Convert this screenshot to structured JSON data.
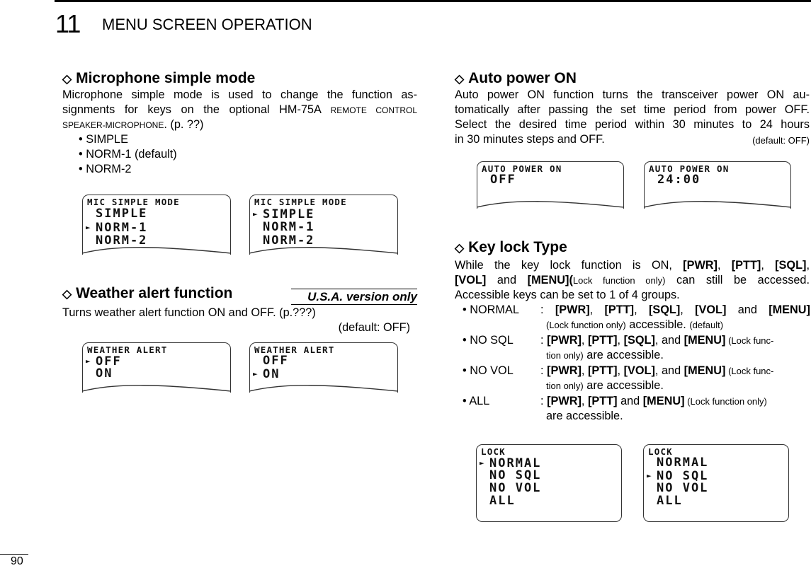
{
  "header": {
    "chapter_number": "11",
    "chapter_title": "MENU SCREEN OPERATION"
  },
  "icons": {
    "section_marker": "diamond-outline-icon",
    "selection_cursor": "triangle-right-icon"
  },
  "sections": {
    "mic": {
      "heading": "Microphone simple mode",
      "para_line1": "Microphone simple mode is used to change the function as-",
      "para_line2_a": "signments for keys on the optional HM-75A ",
      "para_line2_sc": "REMOTE CONTROL",
      "para_line3_sc": "SPEAKER-MICROPHONE",
      "para_line3_b": ". (p. ??)",
      "bullets": [
        "• SIMPLE",
        "• NORM-1 (default)",
        "• NORM-2"
      ],
      "screens": [
        {
          "title": "MIC SIMPLE MODE",
          "rows": [
            "SIMPLE",
            "NORM-1",
            "NORM-2"
          ],
          "selected": 1
        },
        {
          "title": "MIC SIMPLE MODE",
          "rows": [
            "SIMPLE",
            "NORM-1",
            "NORM-2"
          ],
          "selected": 0
        }
      ]
    },
    "weather": {
      "heading": "Weather alert function",
      "badge": "U.S.A. version only",
      "para": "Turns weather alert function ON and OFF. (p.???)",
      "default": "(default: OFF)",
      "screens": [
        {
          "title": "WEATHER ALERT",
          "rows": [
            "OFF",
            "ON"
          ],
          "selected": 0
        },
        {
          "title": "WEATHER ALERT",
          "rows": [
            "OFF",
            "ON"
          ],
          "selected": 1
        }
      ]
    },
    "autopower": {
      "heading": "Auto power ON",
      "lines": [
        "Auto power ON function turns the transceiver power ON au-",
        "tomatically after passing the set time period from power OFF.",
        "Select the desired time period within 30 minutes to 24 hours"
      ],
      "last_line": "in 30 minutes steps and OFF.",
      "default": "(default: OFF)",
      "screens": [
        {
          "title": "AUTO POWER ON",
          "value": "OFF"
        },
        {
          "title": "AUTO POWER ON",
          "value": "24:00"
        }
      ]
    },
    "keylock": {
      "heading": "Key lock Type",
      "intro_l1": {
        "a": "While the key lock function is ON, ",
        "k1": "[PWR]",
        "c1": ", ",
        "k2": "[PTT]",
        "c2": ", ",
        "k3": "[SQL]",
        "c3": ","
      },
      "intro_l2": {
        "k1": "[VOL]",
        "a": " and ",
        "k2": "[MENU](",
        "s": "Lock function only)",
        "b": " can still be accessed."
      },
      "intro_l3": "Accessible keys can be set to 1 of 4 groups.",
      "options": [
        {
          "label": "• NORMAL",
          "sep": ": ",
          "k1": "[PWR]",
          "c1": ", ",
          "k2": "[PTT]",
          "c2": ", ",
          "k3": "[SQL]",
          "c3": ", ",
          "k4": "[VOL]",
          "a": " and ",
          "k5": "[MENU]",
          "s": "(Lock function only)",
          "tail": " accessible. ",
          "s2": "(default)"
        },
        {
          "label": "• NO SQL",
          "sep": ": ",
          "k1": "[PWR]",
          "c1": ", ",
          "k2": "[PTT]",
          "c2": ", ",
          "k3": "[SQL]",
          "a": ", and ",
          "k4": "[MENU]",
          "s": " (Lock func-",
          "s2": "tion only)",
          "tail": " are accessible."
        },
        {
          "label": "• NO VOL",
          "sep": ": ",
          "k1": "[PWR]",
          "c1": ", ",
          "k2": "[PTT]",
          "c2": ", ",
          "k3": "[VOL]",
          "a": ", and ",
          "k4": "[MENU]",
          "s": " (Lock func-",
          "s2": "tion only)",
          "tail": " are accessible."
        },
        {
          "label": "• ALL",
          "sep": ": ",
          "k1": "[PWR]",
          "c1": ", ",
          "k2": "[PTT]",
          "a": " and ",
          "k3": "[MENU]",
          "s": " (Lock function only)",
          "tail": "are accessible."
        }
      ],
      "screens": [
        {
          "title": "LOCK",
          "rows": [
            "NORMAL",
            "NO SQL",
            "NO VOL",
            "ALL"
          ],
          "selected": 0
        },
        {
          "title": "LOCK",
          "rows": [
            "NORMAL",
            "NO SQL",
            "NO VOL",
            "ALL"
          ],
          "selected": 1
        }
      ]
    }
  },
  "footer": {
    "page_number": "90"
  }
}
